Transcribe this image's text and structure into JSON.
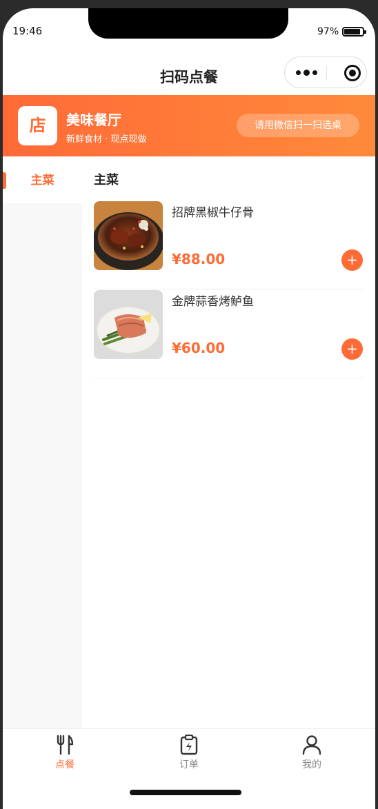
{
  "status_bar": {
    "time": "19:46",
    "battery_pct": "97%"
  },
  "navbar": {
    "title": "扫码点餐"
  },
  "shop": {
    "logo_char": "店",
    "name": "美味餐厅",
    "tagline": "新鲜食材 · 现点现做",
    "scan_label": "请用微信扫一扫选桌"
  },
  "sidebar": {
    "items": [
      {
        "label": "主菜",
        "active": true
      }
    ]
  },
  "menu": {
    "section_title": "主菜",
    "dishes": [
      {
        "name": "招牌黑椒牛仔骨",
        "price": "¥88.00",
        "add_label": "+"
      },
      {
        "name": "金牌蒜香烤鲈鱼",
        "price": "¥60.00",
        "add_label": "+"
      }
    ]
  },
  "tabbar": {
    "items": [
      {
        "label": "点餐",
        "icon": "utensils-icon",
        "active": true
      },
      {
        "label": "订单",
        "icon": "clipboard-icon",
        "active": false
      },
      {
        "label": "我的",
        "icon": "person-icon",
        "active": false
      }
    ]
  },
  "colors": {
    "accent": "#ff6b35",
    "banner_start": "#ff6a37",
    "banner_end": "#ff8a3a"
  }
}
